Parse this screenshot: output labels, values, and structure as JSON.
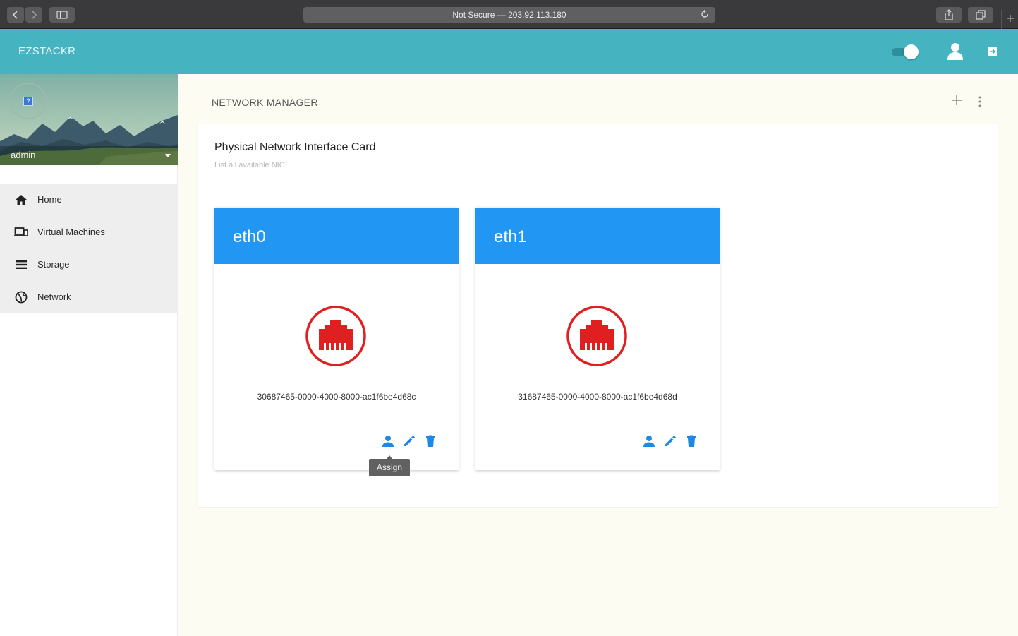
{
  "browser": {
    "address": "Not Secure — 203.92.113.180"
  },
  "app": {
    "brand": "EZSTACKR"
  },
  "sidebar": {
    "user": "admin",
    "items": [
      {
        "label": "Home",
        "icon": "home-icon"
      },
      {
        "label": "Virtual Machines",
        "icon": "devices-icon"
      },
      {
        "label": "Storage",
        "icon": "list-icon"
      },
      {
        "label": "Network",
        "icon": "globe-icon"
      }
    ]
  },
  "main": {
    "title": "NETWORK MANAGER",
    "panel": {
      "title": "Physical Network Interface Card",
      "subtitle": "List all available NIC"
    },
    "cards": [
      {
        "name": "eth0",
        "uuid": "30687465-0000-4000-8000-ac1f6be4d68c"
      },
      {
        "name": "eth1",
        "uuid": "31687465-0000-4000-8000-ac1f6be4d68d"
      }
    ],
    "tooltip": "Assign"
  },
  "colors": {
    "appbar": "#45b3c0",
    "card_header": "#2196f3",
    "nic_icon": "#e02020",
    "action_icon": "#1e88e5"
  }
}
